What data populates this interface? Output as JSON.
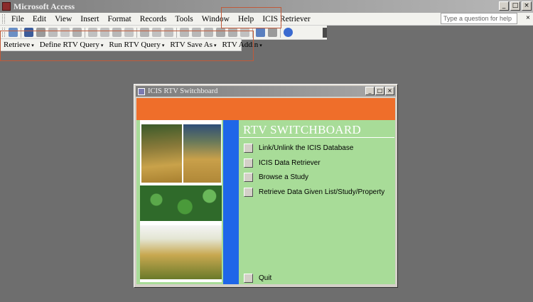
{
  "app": {
    "title": "Microsoft Access"
  },
  "window_buttons": {
    "minimize": "_",
    "maximize": "□",
    "close": "×"
  },
  "menu": {
    "items": [
      {
        "label": "File"
      },
      {
        "label": "Edit"
      },
      {
        "label": "View"
      },
      {
        "label": "Insert"
      },
      {
        "label": "Format"
      },
      {
        "label": "Records"
      },
      {
        "label": "Tools"
      },
      {
        "label": "Window"
      },
      {
        "label": "Help"
      },
      {
        "label": "ICIS Retriever"
      }
    ],
    "help_placeholder": "Type a question for help"
  },
  "rtv_toolbar": {
    "items": [
      {
        "label": "Retrieve"
      },
      {
        "label": "Define RTV Query"
      },
      {
        "label": "Run RTV Query"
      },
      {
        "label": "RTV Save As"
      },
      {
        "label": "RTV Addin"
      }
    ],
    "arrow": "▾"
  },
  "switchboard": {
    "window_title": "ICIS RTV Switchboard",
    "heading": "RTV SWITCHBOARD",
    "options": [
      {
        "label": "Link/Unlink the ICIS Database"
      },
      {
        "label": "ICIS Data Retriever"
      },
      {
        "label": "Browse a Study"
      },
      {
        "label": "Retrieve Data Given List/Study/Property"
      }
    ],
    "quit_label": "Quit"
  },
  "colors": {
    "desktop": "#6e6e6e",
    "orange_band": "#ef6e2a",
    "blue_strip": "#1f66e8",
    "form_green": "#a8dc98",
    "highlight_outline": "#c05a3a"
  }
}
